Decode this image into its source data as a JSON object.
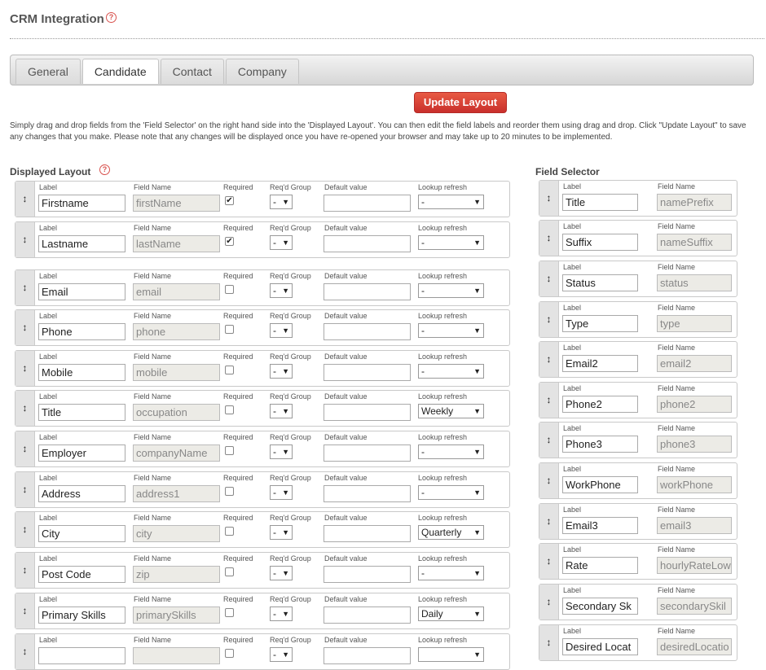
{
  "page": {
    "title": "CRM Integration",
    "help": "?"
  },
  "tabs": [
    "General",
    "Candidate",
    "Contact",
    "Company"
  ],
  "update_button": "Update Layout",
  "intro": "Simply drag and drop fields from the 'Field Selector' on the right hand side into the 'Displayed Layout'. You can then edit the field labels and reorder them using drag and drop. Click \"Update Layout\" to save any changes that you make. Please note that any changes will be displayed once you have re-opened your browser and may take up to 20 minutes to be implemented.",
  "displayed_layout": {
    "title": "Displayed Layout",
    "captions": {
      "label": "Label",
      "field_name": "Field Name",
      "required": "Required",
      "group": "Req'd Group",
      "default": "Default value",
      "lookup": "Lookup refresh"
    },
    "handle": "↕",
    "rows": [
      {
        "label": "Firstname",
        "field": "firstName",
        "required": true,
        "group": "-",
        "default": "",
        "lookup": "-"
      },
      {
        "label": "Lastname",
        "field": "lastName",
        "required": true,
        "group": "-",
        "default": "",
        "lookup": "-"
      },
      {
        "label": "Email",
        "field": "email",
        "required": false,
        "group": "-",
        "default": "",
        "lookup": "-"
      },
      {
        "label": "Phone",
        "field": "phone",
        "required": false,
        "group": "-",
        "default": "",
        "lookup": "-"
      },
      {
        "label": "Mobile",
        "field": "mobile",
        "required": false,
        "group": "-",
        "default": "",
        "lookup": "-"
      },
      {
        "label": "Title",
        "field": "occupation",
        "required": false,
        "group": "-",
        "default": "",
        "lookup": "Weekly"
      },
      {
        "label": "Employer",
        "field": "companyName",
        "required": false,
        "group": "-",
        "default": "",
        "lookup": "-"
      },
      {
        "label": "Address",
        "field": "address1",
        "required": false,
        "group": "-",
        "default": "",
        "lookup": "-"
      },
      {
        "label": "City",
        "field": "city",
        "required": false,
        "group": "-",
        "default": "",
        "lookup": "Quarterly"
      },
      {
        "label": "Post Code",
        "field": "zip",
        "required": false,
        "group": "-",
        "default": "",
        "lookup": "-"
      },
      {
        "label": "Primary Skills",
        "field": "primarySkills",
        "required": false,
        "group": "-",
        "default": "",
        "lookup": "Daily"
      },
      {
        "label": "",
        "field": "",
        "required": false,
        "group": "-",
        "default": "",
        "lookup": ""
      }
    ]
  },
  "field_selector": {
    "title": "Field Selector",
    "captions": {
      "label": "Label",
      "field_name": "Field Name"
    },
    "handle": "↕",
    "rows": [
      {
        "label": "Title",
        "field": "namePrefix"
      },
      {
        "label": "Suffix",
        "field": "nameSuffix"
      },
      {
        "label": "Status",
        "field": "status"
      },
      {
        "label": "Type",
        "field": "type"
      },
      {
        "label": "Email2",
        "field": "email2"
      },
      {
        "label": "Phone2",
        "field": "phone2"
      },
      {
        "label": "Phone3",
        "field": "phone3"
      },
      {
        "label": "WorkPhone",
        "field": "workPhone"
      },
      {
        "label": "Email3",
        "field": "email3"
      },
      {
        "label": "Rate",
        "field": "hourlyRateLow"
      },
      {
        "label": "Secondary Sk",
        "field": "secondarySkil"
      },
      {
        "label": "Desired Locat",
        "field": "desiredLocatio"
      }
    ]
  },
  "colors": {
    "accent": "#d9534f",
    "button": "#c9302c"
  }
}
